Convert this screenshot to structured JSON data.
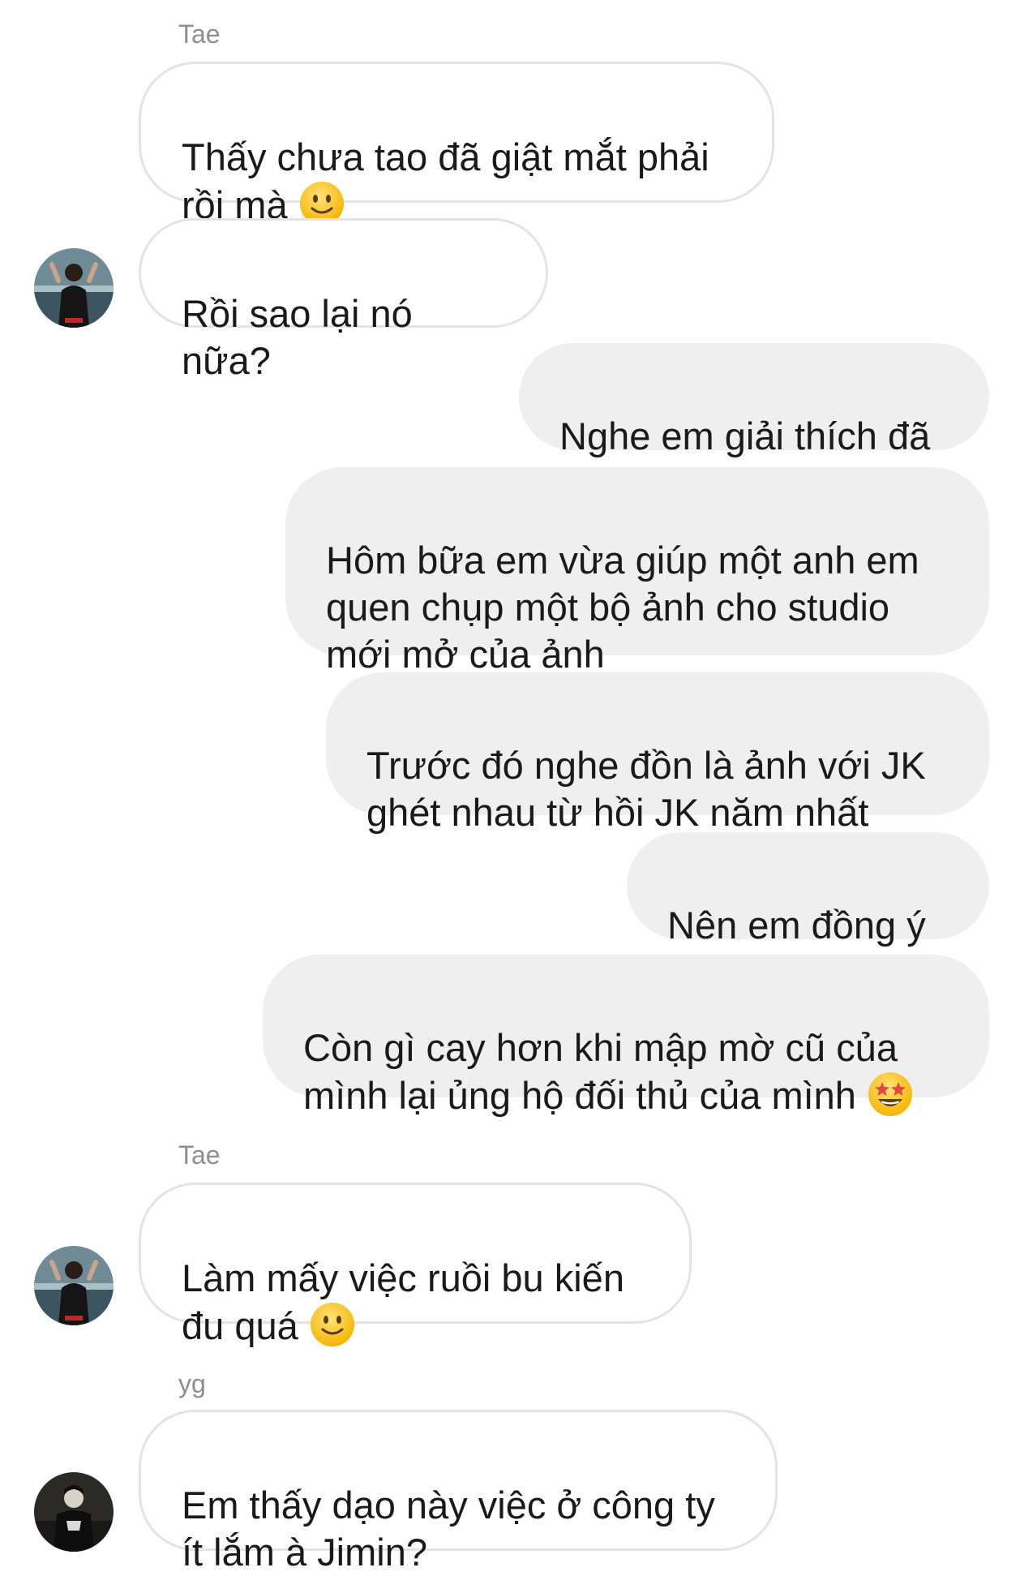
{
  "conversation": {
    "messages": [
      {
        "sender": "Tae",
        "text": "Thấy chưa tao đã giật mắt phải\nrồi mà",
        "emoji": "slightly-smiling-face-icon"
      },
      {
        "text": "Rồi sao lại nó nữa?"
      },
      {
        "text": "Nghe em giải thích đã"
      },
      {
        "text": "Hôm bữa em vừa giúp một anh em\nquen chụp một bộ ảnh cho studio\nmới mở của ảnh"
      },
      {
        "text": "Trước đó nghe đồn là ảnh với JK\nghét nhau từ hồi JK năm nhất"
      },
      {
        "text": "Nên em đồng ý"
      },
      {
        "text": "Còn gì cay hơn khi mập mờ cũ của\nmình lại ủng hộ đối thủ của mình",
        "emoji": "star-struck-face-icon"
      },
      {
        "sender": "Tae",
        "text": "Làm mấy việc ruồi bu kiến\nđu quá",
        "emoji": "slightly-smiling-face-icon"
      },
      {
        "sender": "yg",
        "text": "Em thấy dạo này việc ở công ty\nít lắm à Jimin?"
      }
    ]
  },
  "colors": {
    "incoming_bubble": "#ffffff",
    "incoming_border": "#e4e4e4",
    "outgoing_bubble": "#efefef",
    "sender_name": "#8e8e8e",
    "text": "#1a1a1a"
  }
}
